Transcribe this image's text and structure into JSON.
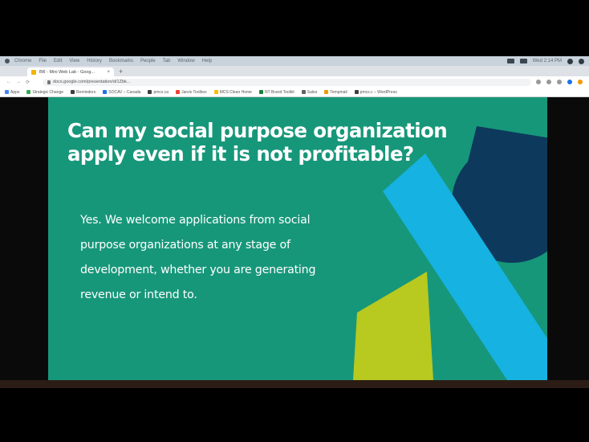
{
  "mac_menubar": {
    "items": [
      "Chrome",
      "File",
      "Edit",
      "View",
      "History",
      "Bookmarks",
      "People",
      "Tab",
      "Window",
      "Help"
    ],
    "clock": "Wed 2:14 PM"
  },
  "browser": {
    "tab_title": "BR - Mini Web Lab - Goog...",
    "tab_close": "×",
    "new_tab": "+",
    "url": "docs.google.com/presentation/d/1Zbk...",
    "bookmarks": [
      "Apps",
      "Strategic Change",
      "Reminders",
      "SOCAV – Canada",
      "pmcs.ca",
      "Jarvis Toolbox",
      "MCS Clean Home",
      "NT Brand Toolkit",
      "Sales",
      "Tempmail",
      "pmcs.c – WordPress"
    ]
  },
  "slide": {
    "headline": "Can my social purpose organization apply even if it is not profitable?",
    "body": "Yes. We welcome applications from social purpose organizations at any stage of development, whether you are generating revenue or intend to.",
    "colors": {
      "background": "#17977a",
      "navy": "#0d3a5c",
      "cyan": "#15b2e2",
      "lime": "#b8c91f"
    }
  }
}
